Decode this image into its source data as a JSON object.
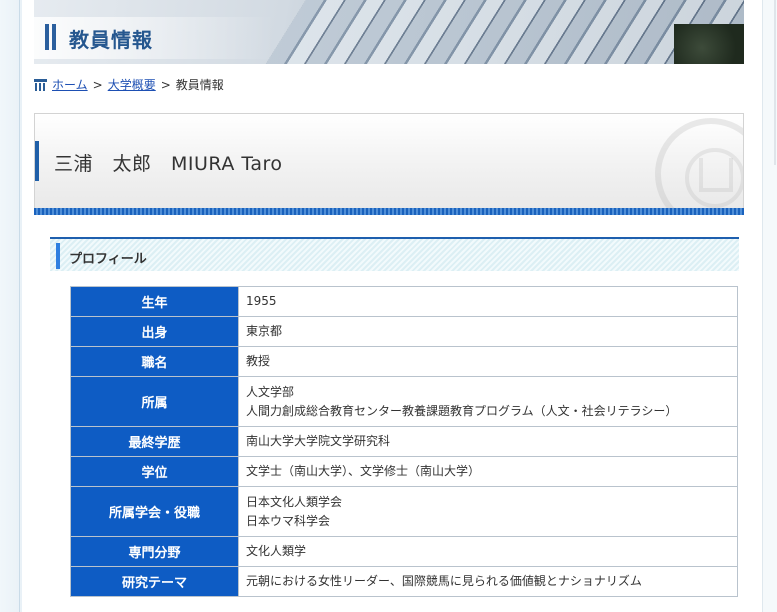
{
  "banner": {
    "title": "教員情報"
  },
  "breadcrumb": {
    "home": "ホーム",
    "parent": "大学概要",
    "current": "教員情報",
    "separator": ">"
  },
  "faculty": {
    "name": "三浦　太郎　MIURA Taro"
  },
  "section": {
    "title": "プロフィール"
  },
  "profile": [
    {
      "label": "生年",
      "values": [
        "1955"
      ]
    },
    {
      "label": "出身",
      "values": [
        "東京都"
      ]
    },
    {
      "label": "職名",
      "values": [
        "教授"
      ]
    },
    {
      "label": "所属",
      "values": [
        "人文学部",
        "人間力創成総合教育センター教養課題教育プログラム（人文・社会リテラシー）"
      ]
    },
    {
      "label": "最終学歴",
      "values": [
        "南山大学大学院文学研究科"
      ]
    },
    {
      "label": "学位",
      "values": [
        "文学士（南山大学）、文学修士（南山大学）"
      ]
    },
    {
      "label": "所属学会・役職",
      "values": [
        "日本文化人類学会",
        "日本ウマ科学会"
      ]
    },
    {
      "label": "専門分野",
      "values": [
        "文化人類学"
      ]
    },
    {
      "label": "研究テーマ",
      "values": [
        "元朝における女性リーダー、国際競馬に見られる価値観とナショナリズム"
      ]
    }
  ],
  "colors": {
    "header_cell": "#0e5cc4",
    "accent": "#1f5fa8",
    "link": "#1d4fb3"
  },
  "icons": {
    "breadcrumb_home": "building-icon"
  }
}
